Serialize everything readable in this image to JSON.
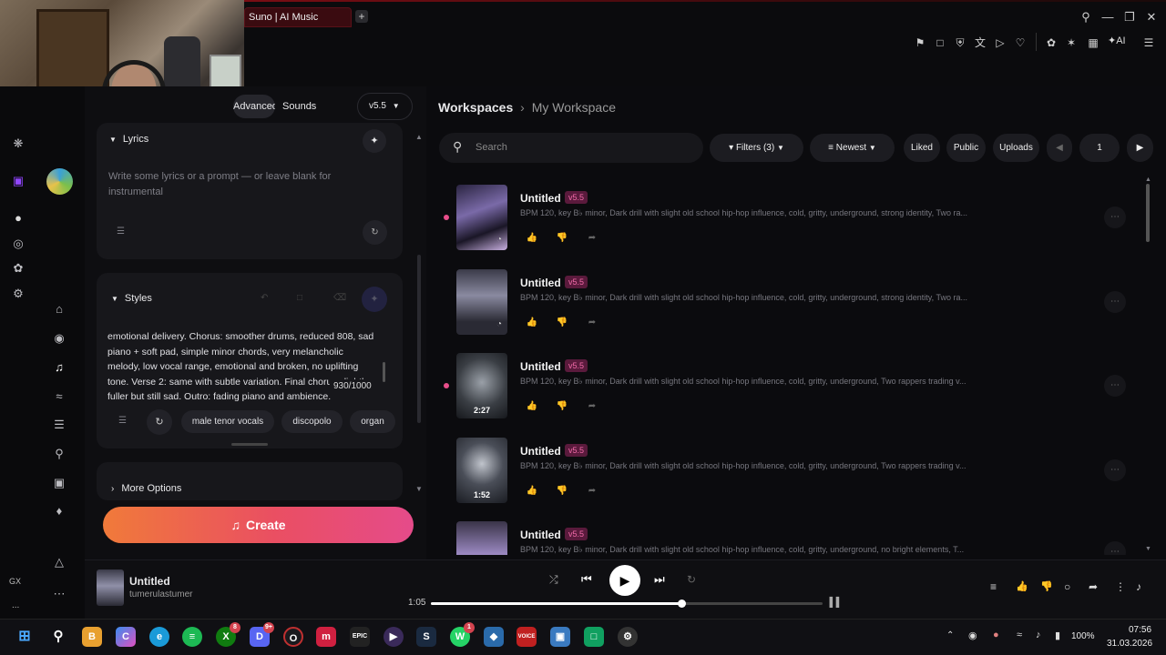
{
  "browser": {
    "tab_title": "Suno | AI Music",
    "new_tab": "+",
    "ai_label": "AI"
  },
  "sidebar": {
    "gx_label": "GX",
    "more": "..."
  },
  "left": {
    "mode_tabs": [
      "Advanced",
      "Sounds"
    ],
    "version": "v5.5",
    "lyrics": {
      "label": "Lyrics",
      "placeholder": "Write some lyrics or a prompt — or leave blank for instrumental"
    },
    "styles": {
      "label": "Styles",
      "text": "emotional delivery. Chorus: smoother drums, reduced 808, sad piano + soft pad, simple minor chords, very melancholic melody, low vocal range, emotional and broken, no uplifting tone. Verse 2: same with subtle variation. Final chorus slightly fuller but still sad. Outro: fading piano and ambience.",
      "counter": "930/1000",
      "chips": [
        "male tenor vocals",
        "discopolo",
        "organ"
      ]
    },
    "more_options": "More Options",
    "create": "Create"
  },
  "workspace": {
    "breadcrumb_root": "Workspaces",
    "breadcrumb_current": "My Workspace",
    "search_placeholder": "Search",
    "filters": "Filters (3)",
    "sort": "Newest",
    "liked": "Liked",
    "public": "Public",
    "uploads": "Uploads",
    "page": "1"
  },
  "songs": [
    {
      "title": "Untitled",
      "version": "v5.5",
      "desc": "BPM 120, key B♭ minor, Dark drill with slight old school hip-hop influence, cold, gritty, underground, strong identity, Two ra...",
      "duration": ""
    },
    {
      "title": "Untitled",
      "version": "v5.5",
      "desc": "BPM 120, key B♭ minor, Dark drill with slight old school hip-hop influence, cold, gritty, underground, strong identity, Two ra...",
      "duration": ""
    },
    {
      "title": "Untitled",
      "version": "v5.5",
      "desc": "BPM 120, key B♭ minor, Dark drill with slight old school hip-hop influence, cold, gritty, underground, Two rappers trading v...",
      "duration": "2:27"
    },
    {
      "title": "Untitled",
      "version": "v5.5",
      "desc": "BPM 120, key B♭ minor, Dark drill with slight old school hip-hop influence, cold, gritty, underground, Two rappers trading v...",
      "duration": "1:52"
    },
    {
      "title": "Untitled",
      "version": "v5.5",
      "desc": "BPM 120, key B♭ minor, Dark drill with slight old school hip-hop influence, cold, gritty, underground, no bright elements, T...",
      "duration": ""
    }
  ],
  "player": {
    "title": "Untitled",
    "artist": "tumerulastumer",
    "time": "1:05",
    "progress": 0.64
  },
  "taskbar": {
    "badge_xbox": "8",
    "badge_discord": "9+",
    "badge_whatsapp": "1",
    "battery": "100%",
    "time": "07:56",
    "date": "31.03.2026"
  },
  "colors": {
    "accent_pink": "#e84e8a",
    "create_gradient_start": "#f07a3a",
    "create_gradient_end": "#e54b8a"
  }
}
